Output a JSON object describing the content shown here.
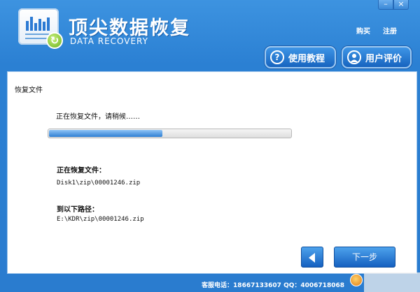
{
  "header": {
    "brand_title": "顶尖数据恢复",
    "brand_subtitle": "DATA RECOVERY",
    "link_buy": "购买",
    "link_register": "注册",
    "btn_tutorial": "使用教程",
    "btn_review": "用户评价",
    "tutorial_icon": "?",
    "minimize_glyph": "–",
    "close_glyph": "×"
  },
  "content": {
    "section_title": "恢复文件",
    "status_text": "正在恢复文件，请稍候……",
    "progress_fraction": 0.47,
    "current_file_label": "正在恢复文件：",
    "current_file_path": "Disk1\\zip\\00001246.zip",
    "destination_label": "到以下路径：",
    "destination_path": "E:\\KDR\\zip\\00001246.zip"
  },
  "nav": {
    "next_label": "下一步"
  },
  "footer": {
    "contact_text": "客服电话：18667133607 QQ：4006718068"
  },
  "colors": {
    "brand_blue": "#2a7ccf",
    "progress_blue": "#2f7fd2"
  }
}
